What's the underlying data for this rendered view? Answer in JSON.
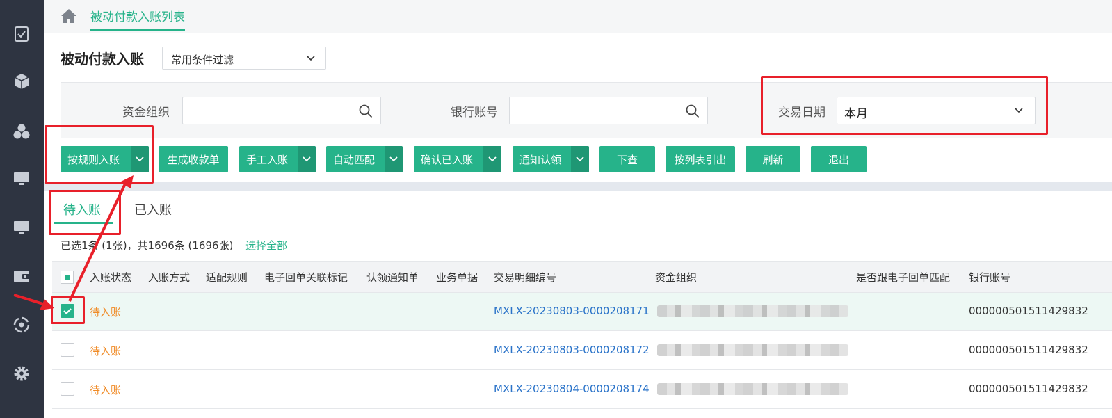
{
  "breadcrumb": {
    "tab_label": "被动付款入账列表"
  },
  "header": {
    "title": "被动付款入账",
    "filter_select": "常用条件过滤"
  },
  "search": {
    "fund_org_label": "资金组织",
    "fund_org_value": "",
    "bank_account_label": "银行账号",
    "bank_account_value": "",
    "trade_date_label": "交易日期",
    "trade_date_value": "本月"
  },
  "toolbar": {
    "rule_entry": "按规则入账",
    "gen_receipt": "生成收款单",
    "manual_entry": "手工入账",
    "auto_match": "自动匹配",
    "confirm_entry": "确认已入账",
    "notify_claim": "通知认领",
    "drill_down": "下查",
    "export_list": "按列表引出",
    "refresh": "刷新",
    "exit": "退出"
  },
  "tabs": {
    "pending": "待入账",
    "done": "已入账"
  },
  "selection": {
    "info": "已选1条 (1张)，共1696条 (1696张)",
    "select_all": "选择全部"
  },
  "table": {
    "columns": [
      "入账状态",
      "入账方式",
      "适配规则",
      "电子回单关联标记",
      "认领通知单",
      "业务单据",
      "交易明细编号",
      "资金组织",
      "是否跟电子回单匹配",
      "银行账号"
    ],
    "rows": [
      {
        "checked": true,
        "status": "待入账",
        "txn_no": "MXLX-20230803-0000208171",
        "account": "000000501511429832"
      },
      {
        "checked": false,
        "status": "待入账",
        "txn_no": "MXLX-20230803-0000208172",
        "account": "000000501511429832"
      },
      {
        "checked": false,
        "status": "待入账",
        "txn_no": "MXLX-20230804-0000208174",
        "account": "000000501511429832"
      }
    ]
  },
  "colors": {
    "accent": "#26b38a",
    "accent_dark": "#1f9774",
    "sidebar": "#2e3441",
    "status_orange": "#f08a24",
    "link_blue": "#2a73c9",
    "annotation_red": "#e8202a"
  },
  "icons": {
    "sidebar": [
      "checklist-icon",
      "cube-icon",
      "cluster-icon",
      "monitor-icon",
      "monitor-icon",
      "wallet-icon",
      "sync-icon",
      "gear-icon"
    ],
    "other": [
      "home-icon",
      "search-icon",
      "chevron-down-icon",
      "check-icon"
    ]
  }
}
